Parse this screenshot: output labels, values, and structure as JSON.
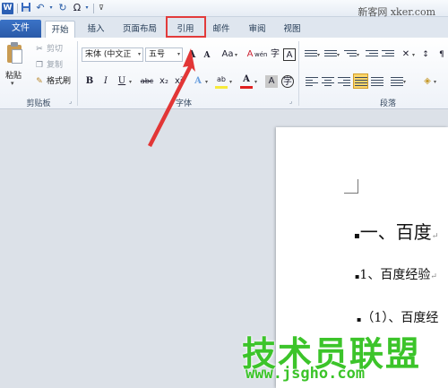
{
  "qat": {
    "app_icon": "W",
    "redo_glyph": "Ω"
  },
  "watermark_top": "新客网 xker.com",
  "tabs": {
    "file": "文件",
    "items": [
      {
        "label": "开始",
        "active": true
      },
      {
        "label": "插入"
      },
      {
        "label": "页面布局"
      },
      {
        "label": "引用",
        "highlighted": true
      },
      {
        "label": "邮件"
      },
      {
        "label": "审阅"
      },
      {
        "label": "视图"
      }
    ]
  },
  "clipboard": {
    "paste": "粘贴",
    "cut": "剪切",
    "copy": "复制",
    "format_painter": "格式刷",
    "group": "剪贴板"
  },
  "font": {
    "name": "宋体 (中文正",
    "size": "五号",
    "grow": "A",
    "shrink": "A",
    "case": "Aa",
    "clear": "A",
    "phonetic": "wén",
    "encircle": "字",
    "border": "A",
    "bold": "B",
    "italic": "I",
    "underline": "U",
    "strike": "abc",
    "sub": "x₂",
    "sup": "x²",
    "effects": "A",
    "highlight": "ab",
    "color": "A",
    "char_shading": "A",
    "enclose": "字",
    "group": "字体",
    "colors": {
      "highlight": "#f7ea3c",
      "font_color": "#e02020"
    }
  },
  "paragraph": {
    "group": "段落"
  },
  "document": {
    "line1": "一、百度",
    "line2": "1、百度经验",
    "line3": "（1）、百度经"
  },
  "watermark_bottom": {
    "logo": "技术员联盟",
    "url": "www.jsgho.com"
  }
}
